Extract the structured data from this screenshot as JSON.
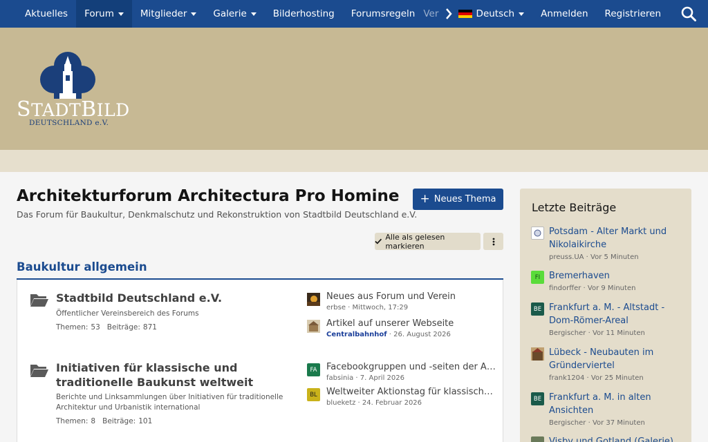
{
  "nav": {
    "items": [
      {
        "label": "Aktuelles",
        "caret": false,
        "active": false
      },
      {
        "label": "Forum",
        "caret": true,
        "active": true
      },
      {
        "label": "Mitglieder",
        "caret": true,
        "active": false
      },
      {
        "label": "Galerie",
        "caret": true,
        "active": false
      },
      {
        "label": "Bilderhosting",
        "caret": false,
        "active": false
      },
      {
        "label": "Forumsregeln",
        "caret": false,
        "active": false
      }
    ],
    "partial": "Ver",
    "language": "Deutsch",
    "login": "Anmelden",
    "register": "Registrieren"
  },
  "logo": {
    "word_big": "S",
    "word_a": "TADT",
    "word_big2": "B",
    "word_b": "ILD",
    "sub": "DEUTSCHLAND e.V."
  },
  "page": {
    "title": "Architekturforum Architectura Pro Homine",
    "subtitle": "Das Forum für Baukultur, Denkmalschutz und Rekonstruktion von Stadtbild Deutschland e.V.",
    "new_thread": "Neues Thema",
    "mark_read": "Alle als gelesen markieren"
  },
  "category": {
    "title": "Baukultur allgemein",
    "nodes": [
      {
        "title": "Stadtbild Deutschland e.V.",
        "desc": "Öffentlicher Vereinsbereich des Forums",
        "threads_label": "Themen:",
        "threads": "53",
        "posts_label": "Beiträge:",
        "posts": "871",
        "latest": [
          {
            "title": "Neues aus Forum und Verein",
            "user": "erbse",
            "date": "Mittwoch, 17:29",
            "avatar": "",
            "color": "#7a5a2a",
            "user_link": false
          },
          {
            "title": "Artikel auf unserer Webseite",
            "user": "Centralbahnhof",
            "date": "26. August 2026",
            "avatar": "",
            "color": "#b9a27a",
            "user_link": true
          }
        ]
      },
      {
        "title": "Initiativen für klassische und traditionelle Baukunst weltweit",
        "desc": "Berichte und Linksammlungen über Initiativen für traditionelle Architektur und Urbanistik international",
        "threads_label": "Themen:",
        "threads": "8",
        "posts_label": "Beiträge:",
        "posts": "101",
        "latest": [
          {
            "title": "Facebookgruppen und -seiten der Arc...",
            "user": "fabsinia",
            "date": "7. April 2026",
            "avatar": "FA",
            "color": "#1a7a4c",
            "user_link": false
          },
          {
            "title": "Weltweiter Aktionstag für klassische/t...",
            "user": "blueketz",
            "date": "24. Februar 2026",
            "avatar": "BL",
            "color": "#c9b21a",
            "user_link": false
          }
        ]
      }
    ]
  },
  "sidebar": {
    "title": "Letzte Beiträge",
    "posts": [
      {
        "title": "Potsdam - Alter Markt und Nikolaikirche",
        "user": "preuss.UA",
        "time": "Vor 5 Minuten",
        "avatar": "",
        "color": "#ffffff"
      },
      {
        "title": "Bremerhaven",
        "user": "findorffer",
        "time": "Vor 9 Minuten",
        "avatar": "FI",
        "color": "#5adc3a"
      },
      {
        "title": "Frankfurt a. M. - Altstadt - Dom-Römer-Areal",
        "user": "Bergischer",
        "time": "Vor 11 Minuten",
        "avatar": "BE",
        "color": "#1a5a4a"
      },
      {
        "title": "Lübeck - Neubauten im Gründerviertel",
        "user": "frank1204",
        "time": "Vor 25 Minuten",
        "avatar": "",
        "color": "#8a6a3a"
      },
      {
        "title": "Frankfurt a. M. in alten Ansichten",
        "user": "Bergischer",
        "time": "Vor 37 Minuten",
        "avatar": "BE",
        "color": "#1a5a4a"
      },
      {
        "title": "Visby und Gotland (Galerie)",
        "user": "",
        "time": "",
        "avatar": "",
        "color": "#6a7a5a"
      }
    ]
  },
  "colors": {
    "primary": "#1b4b8f",
    "banner": "#c7b994",
    "sidebar": "#e4ddcb"
  }
}
